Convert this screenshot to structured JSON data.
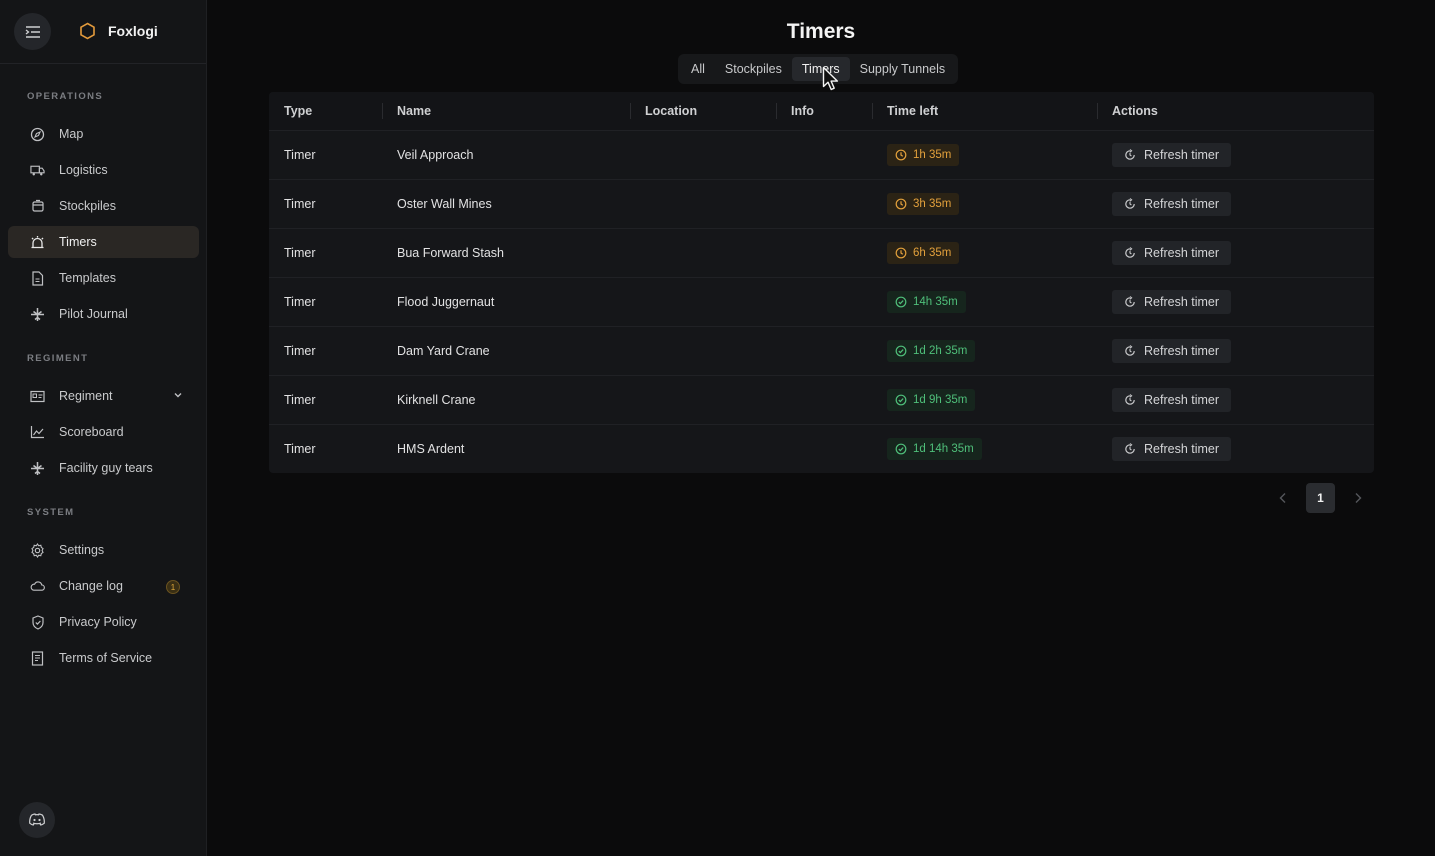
{
  "app": {
    "name": "Foxlogi",
    "page_title": "Timers"
  },
  "sidebar": {
    "sections": [
      {
        "title": "OPERATIONS",
        "items": [
          {
            "label": "Map",
            "icon": "compass-icon"
          },
          {
            "label": "Logistics",
            "icon": "truck-icon"
          },
          {
            "label": "Stockpiles",
            "icon": "box-icon"
          },
          {
            "label": "Timers",
            "icon": "alarm-icon",
            "active": true
          },
          {
            "label": "Templates",
            "icon": "file-icon"
          },
          {
            "label": "Pilot Journal",
            "icon": "plane-icon"
          }
        ]
      },
      {
        "title": "REGIMENT",
        "items": [
          {
            "label": "Regiment",
            "icon": "id-card-icon",
            "expandable": true
          },
          {
            "label": "Scoreboard",
            "icon": "chart-line-icon"
          },
          {
            "label": "Facility guy tears",
            "icon": "plane-icon"
          }
        ]
      },
      {
        "title": "SYSTEM",
        "items": [
          {
            "label": "Settings",
            "icon": "gear-icon"
          },
          {
            "label": "Change log",
            "icon": "cloud-icon",
            "badge": "1"
          },
          {
            "label": "Privacy Policy",
            "icon": "shield-icon"
          },
          {
            "label": "Terms of Service",
            "icon": "document-icon"
          }
        ]
      }
    ]
  },
  "tabs": [
    "All",
    "Stockpiles",
    "Timers",
    "Supply Tunnels"
  ],
  "active_tab": "Timers",
  "table": {
    "columns": [
      "Type",
      "Name",
      "Location",
      "Info",
      "Time left",
      "Actions"
    ],
    "rows": [
      {
        "type": "Timer",
        "name": "Veil Approach",
        "location": "",
        "info": "",
        "time_left": "1h 35m",
        "status": "warning",
        "action": "Refresh timer"
      },
      {
        "type": "Timer",
        "name": "Oster Wall Mines",
        "location": "",
        "info": "",
        "time_left": "3h 35m",
        "status": "warning",
        "action": "Refresh timer"
      },
      {
        "type": "Timer",
        "name": "Bua Forward Stash",
        "location": "",
        "info": "",
        "time_left": "6h 35m",
        "status": "warning",
        "action": "Refresh timer"
      },
      {
        "type": "Timer",
        "name": "Flood Juggernaut",
        "location": "",
        "info": "",
        "time_left": "14h 35m",
        "status": "ok",
        "action": "Refresh timer"
      },
      {
        "type": "Timer",
        "name": "Dam Yard Crane",
        "location": "",
        "info": "",
        "time_left": "1d 2h 35m",
        "status": "ok",
        "action": "Refresh timer"
      },
      {
        "type": "Timer",
        "name": "Kirknell Crane",
        "location": "",
        "info": "",
        "time_left": "1d 9h 35m",
        "status": "ok",
        "action": "Refresh timer"
      },
      {
        "type": "Timer",
        "name": "HMS Ardent",
        "location": "",
        "info": "",
        "time_left": "1d 14h 35m",
        "status": "ok",
        "action": "Refresh timer"
      }
    ]
  },
  "pagination": {
    "current_page": "1"
  },
  "colors": {
    "warning": "#e3a13c",
    "ok": "#4fbf7a",
    "brand_hex": "#e39a3c"
  }
}
